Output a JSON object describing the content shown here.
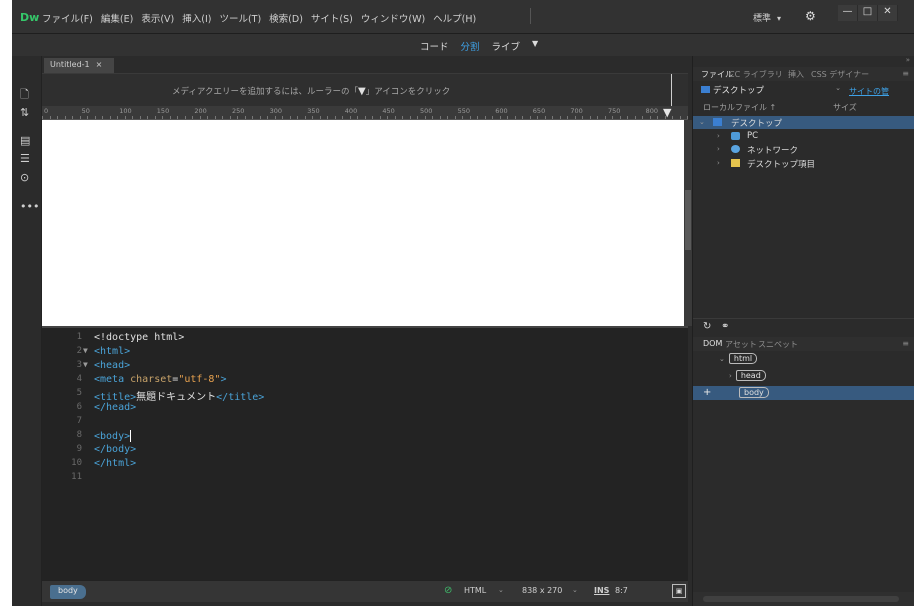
{
  "app": {
    "logo": "Dw",
    "menu": [
      "ファイル(F)",
      "編集(E)",
      "表示(V)",
      "挿入(I)",
      "ツール(T)",
      "検索(D)",
      "サイト(S)",
      "ウィンドウ(W)",
      "ヘルプ(H)"
    ],
    "workspace": "標準",
    "window_controls": [
      "—",
      "□",
      "✕"
    ]
  },
  "view_switch": {
    "tabs": [
      "コード",
      "分割",
      "ライブ"
    ],
    "active": "分割"
  },
  "document": {
    "tab_title": "Untitled-1",
    "tab_close": "×",
    "info_text_pre": "メディアクエリーを追加するには、ルーラーの「",
    "info_text_post": "」アイコンをクリック",
    "ruler_ticks": [
      "0",
      "50",
      "100",
      "150",
      "200",
      "250",
      "300",
      "350",
      "400",
      "450",
      "500",
      "550",
      "600",
      "650",
      "700",
      "750",
      "800"
    ]
  },
  "code": {
    "lines": [
      {
        "n": "1",
        "fold": "",
        "parts": [
          {
            "t": "<!doctype html>",
            "c": "plain"
          }
        ]
      },
      {
        "n": "2",
        "fold": "▼",
        "parts": [
          {
            "t": "<html>",
            "c": "tag"
          }
        ]
      },
      {
        "n": "3",
        "fold": "▼",
        "parts": [
          {
            "t": "<head>",
            "c": "tag"
          }
        ]
      },
      {
        "n": "4",
        "fold": "",
        "parts": [
          {
            "t": "<meta ",
            "c": "tag"
          },
          {
            "t": "charset",
            "c": "attr"
          },
          {
            "t": "=",
            "c": "plain"
          },
          {
            "t": "\"utf-8\"",
            "c": "str"
          },
          {
            "t": ">",
            "c": "tag"
          }
        ]
      },
      {
        "n": "5",
        "fold": "",
        "parts": [
          {
            "t": "<title>",
            "c": "tag"
          },
          {
            "t": "無題ドキュメント",
            "c": "plain"
          },
          {
            "t": "</title>",
            "c": "tag"
          }
        ]
      },
      {
        "n": "6",
        "fold": "",
        "parts": [
          {
            "t": "</head>",
            "c": "tag"
          }
        ]
      },
      {
        "n": "7",
        "fold": "",
        "parts": []
      },
      {
        "n": "8",
        "fold": "",
        "parts": [
          {
            "t": "<body>",
            "c": "tag"
          }
        ]
      },
      {
        "n": "9",
        "fold": "",
        "parts": [
          {
            "t": "</body>",
            "c": "tag"
          }
        ]
      },
      {
        "n": "10",
        "fold": "",
        "parts": [
          {
            "t": "</html>",
            "c": "tag"
          }
        ]
      },
      {
        "n": "11",
        "fold": "",
        "parts": []
      }
    ]
  },
  "status": {
    "breadcrumb": "body",
    "language": "HTML",
    "size": "838 x 270",
    "mode": "INS",
    "position": "8:7"
  },
  "files_panel": {
    "tabs": [
      "ファイル",
      "CC ライブラリ",
      "挿入",
      "CSS デザイナー"
    ],
    "active_tab": "ファイル",
    "site": "デスクトップ",
    "site_link": "サイトの管",
    "col_local": "ローカルファイル ↑",
    "col_size": "サイズ",
    "tree": [
      {
        "label": "デスクトップ",
        "level": 0,
        "expanded": true,
        "icon": "desktop-icon",
        "selected": true
      },
      {
        "label": "PC",
        "level": 1,
        "expanded": false,
        "icon": "pc-icon",
        "selected": false
      },
      {
        "label": "ネットワーク",
        "level": 1,
        "expanded": false,
        "icon": "network-icon",
        "selected": false
      },
      {
        "label": "デスクトップ項目",
        "level": 1,
        "expanded": false,
        "icon": "folder-icon",
        "selected": false
      }
    ]
  },
  "dom_panel": {
    "tabs": [
      "DOM",
      "アセット",
      "スニペット"
    ],
    "active_tab": "DOM",
    "nodes": [
      {
        "label": "html",
        "level": 0,
        "expander": "⌄"
      },
      {
        "label": "head",
        "level": 1,
        "expander": "›"
      },
      {
        "label": "body",
        "level": 1,
        "expander": ""
      }
    ]
  },
  "colors": {
    "accent": "#3ea1e6",
    "logo": "#35c76a",
    "selection": "#375a7f",
    "background": "#2b2b2b"
  }
}
